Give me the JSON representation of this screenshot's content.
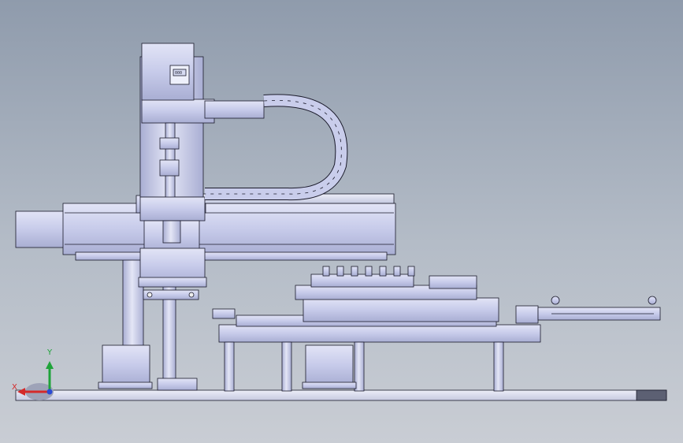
{
  "viewport": {
    "kind": "CAD assembly model, front view",
    "colors": {
      "background_top": "#8f9bac",
      "background_bottom": "#c9cdd4",
      "part_fill": "#c9cdeb",
      "part_fill_light": "#dcdff3",
      "part_fill_dark": "#9ea4c8",
      "edge_line": "#1a1a2a",
      "axis_x": "#d42a2a",
      "axis_y": "#1fa33a",
      "axis_z": "#2a4ad4"
    }
  },
  "triad": {
    "x_label": "X",
    "y_label": "Y",
    "icon": "coordinate-triad-icon"
  },
  "parts": [
    {
      "id": "servo-motor",
      "icon": "servo-motor-icon"
    },
    {
      "id": "cable-carrier",
      "icon": "drag-chain-icon"
    },
    {
      "id": "linear-module",
      "icon": "linear-actuator-icon"
    },
    {
      "id": "vertical-slide",
      "icon": "z-axis-slide-icon"
    },
    {
      "id": "lift-column",
      "icon": "column-icon"
    },
    {
      "id": "work-table",
      "icon": "table-icon"
    },
    {
      "id": "fixture-platen",
      "icon": "fixture-icon"
    },
    {
      "id": "side-cylinder",
      "icon": "pneumatic-cylinder-icon"
    },
    {
      "id": "base-plate",
      "icon": "base-plate-icon"
    }
  ]
}
